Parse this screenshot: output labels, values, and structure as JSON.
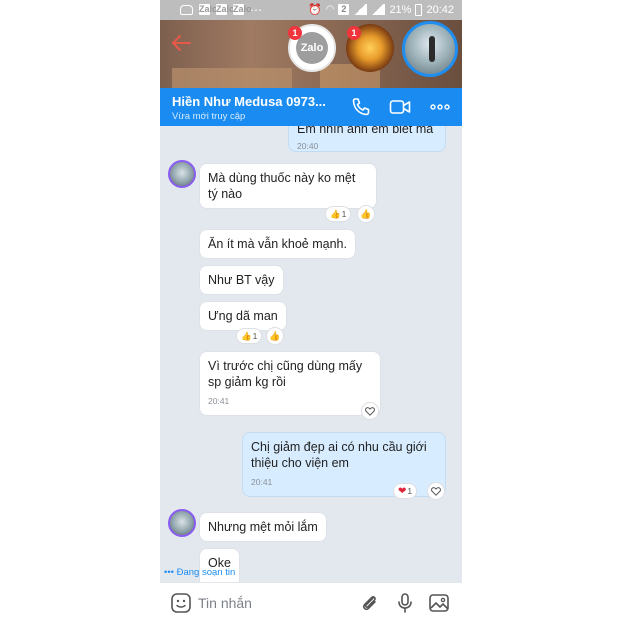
{
  "status_bar": {
    "sim_label": "2",
    "battery": "21%",
    "time": "20:42",
    "left_box_labels": [
      "Zalo",
      "Zalo",
      "Zalo"
    ]
  },
  "bubble_heads": {
    "zalo_label": "Zalo",
    "zalo_badge": "1",
    "second_badge": "1"
  },
  "header": {
    "contact_name": "Hiền Như Medusa 0973...",
    "last_seen": "Vừa mới truy cập"
  },
  "messages": [
    {
      "text": "Em nhìn anh em biết mà",
      "time": "20:40",
      "mine": true
    },
    {
      "text": "Mà dùng thuốc này ko mệt tý nào",
      "mine": false,
      "reaction_count": "1"
    },
    {
      "text": "Ăn ít mà vẫn khoẻ mạnh.",
      "mine": false
    },
    {
      "text": "Như BT vậy",
      "mine": false
    },
    {
      "text": "Ưng dã man",
      "mine": false,
      "reaction_count": "1"
    },
    {
      "text": "Vì trước chị cũng dùng mấy sp giảm kg rồi",
      "time": "20:41",
      "mine": false
    },
    {
      "text": "Chị giảm đẹp ai có nhu cầu giới thiệu cho viện em",
      "time": "20:41",
      "mine": true,
      "reaction_count": "1"
    },
    {
      "text": "Nhưng mệt mỏi lắm",
      "mine": false
    },
    {
      "text": "Oke",
      "mine": false
    }
  ],
  "typing_indicator": "Đang soạn tin",
  "input": {
    "placeholder": "Tin nhắn"
  },
  "colors": {
    "header_blue": "#1a8cf1",
    "my_bubble": "#d7ecff",
    "their_bubble": "#ffffff",
    "chat_bg": "#e3e8ef",
    "heart": "#e0263a"
  }
}
